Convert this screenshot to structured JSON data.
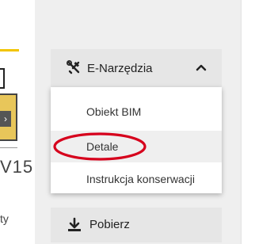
{
  "left_fragment": {
    "text_1": "V15",
    "text_2": "ty"
  },
  "tools_menu": {
    "label": "E-Narzędzia",
    "icon": "tools-icon",
    "expanded": true,
    "items": [
      {
        "label": "Obiekt BIM"
      },
      {
        "label": "Detale",
        "highlighted": true
      },
      {
        "label": "Instrukcja konserwacji"
      }
    ]
  },
  "download": {
    "label": "Pobierz",
    "icon": "download-icon"
  },
  "colors": {
    "accent_yellow": "#f2c400",
    "annotation_red": "#d6001c"
  }
}
